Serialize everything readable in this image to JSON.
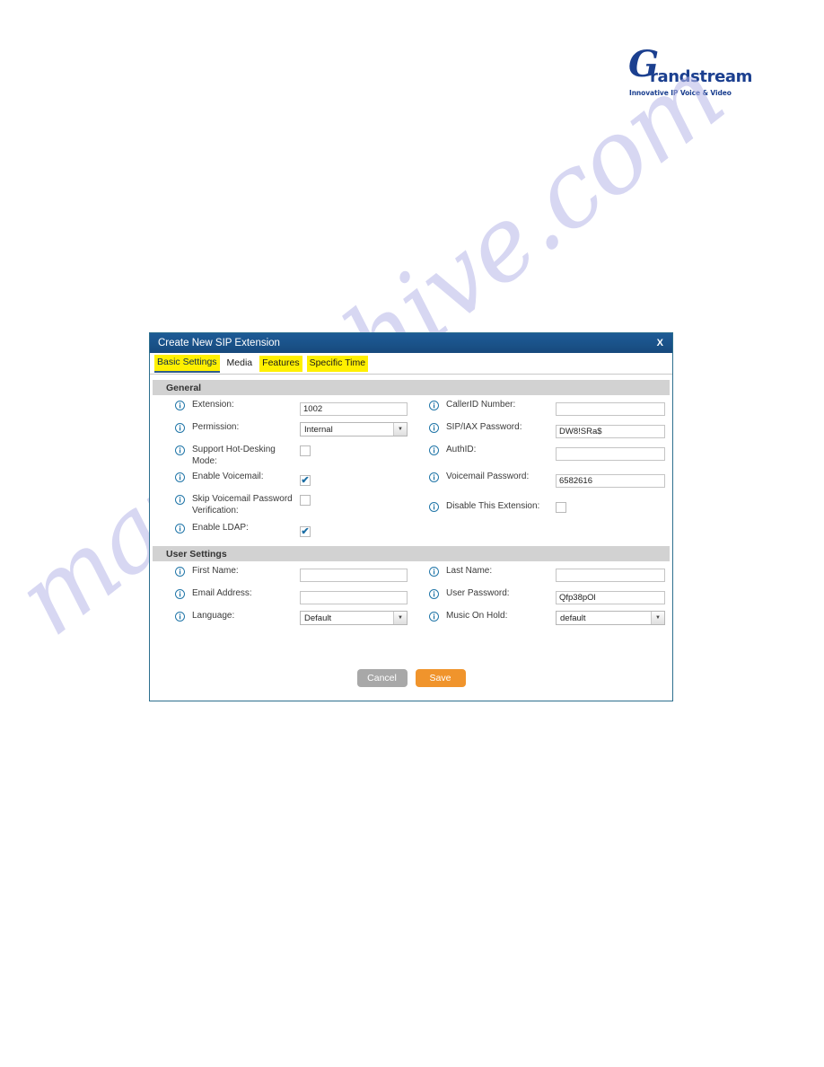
{
  "watermark": {
    "text": "manualshive.com"
  },
  "logo": {
    "mark": "G",
    "word": "randstream",
    "tagline": "Innovative IP Voice & Video",
    "color": "#1b3f8f"
  },
  "dialog": {
    "title": "Create New SIP Extension",
    "close_label": "X",
    "tabs": [
      {
        "label": "Basic Settings",
        "highlighted": true,
        "active": true
      },
      {
        "label": "Media",
        "highlighted": false,
        "active": false
      },
      {
        "label": "Features",
        "highlighted": true,
        "active": false
      },
      {
        "label": "Specific Time",
        "highlighted": true,
        "active": false
      }
    ],
    "sections": [
      {
        "heading": "General",
        "fields": {
          "extension": {
            "label": "Extension:",
            "value": "1002"
          },
          "callerid_number": {
            "label": "CallerID Number:",
            "value": ""
          },
          "permission": {
            "label": "Permission:",
            "value": "Internal"
          },
          "sip_iax_password": {
            "label": "SIP/IAX Password:",
            "value": "DW8!SRa$"
          },
          "hot_desking": {
            "label": "Support Hot-Desking Mode:",
            "checked": false
          },
          "auth_id": {
            "label": "AuthID:",
            "value": ""
          },
          "enable_voicemail": {
            "label": "Enable Voicemail:",
            "checked": true
          },
          "voicemail_pass": {
            "label": "Voicemail Password:",
            "value": "6582616"
          },
          "skip_vm_verify": {
            "label": "Skip Voicemail Password Verification:",
            "checked": false
          },
          "disable_ext": {
            "label": "Disable This Extension:",
            "checked": false
          },
          "enable_ldap": {
            "label": "Enable LDAP:",
            "checked": true
          }
        }
      },
      {
        "heading": "User Settings",
        "fields": {
          "first_name": {
            "label": "First Name:",
            "value": ""
          },
          "last_name": {
            "label": "Last Name:",
            "value": ""
          },
          "email_address": {
            "label": "Email Address:",
            "value": ""
          },
          "user_password": {
            "label": "User Password:",
            "value": "Qfp38pOl"
          },
          "language": {
            "label": "Language:",
            "value": "Default"
          },
          "music_on_hold": {
            "label": "Music On Hold:",
            "value": "default"
          }
        }
      }
    ],
    "buttons": {
      "cancel": "Cancel",
      "save": "Save"
    },
    "colors": {
      "titlebar": "#1a5289",
      "save": "#f0942c",
      "cancel": "#a8a8a8",
      "highlight": "#fff000"
    }
  }
}
